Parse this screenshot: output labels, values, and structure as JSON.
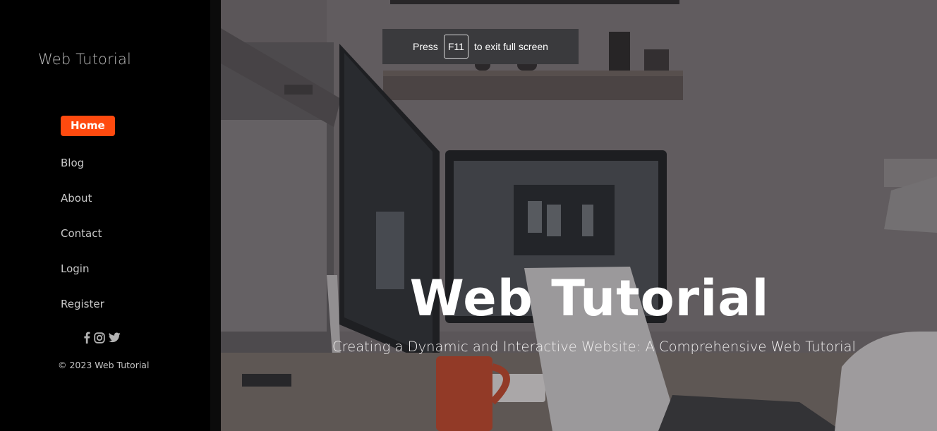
{
  "sidebar": {
    "brand": "Web Tutorial",
    "nav": [
      {
        "label": "Home",
        "active": true
      },
      {
        "label": "Blog",
        "active": false
      },
      {
        "label": "About",
        "active": false
      },
      {
        "label": "Contact",
        "active": false
      },
      {
        "label": "Login",
        "active": false
      },
      {
        "label": "Register",
        "active": false
      }
    ],
    "social_icons": [
      "facebook-icon",
      "instagram-icon",
      "twitter-icon"
    ],
    "copyright": "© 2023 Web Tutorial"
  },
  "hero": {
    "title": "Web Tutorial",
    "subtitle": "Creating a Dynamic and Interactive Website: A Comprehensive Web Tutorial"
  },
  "fullscreen_notice": {
    "prefix": "Press",
    "key": "F11",
    "suffix": "to exit full screen"
  },
  "colors": {
    "accent": "#ff4a0f",
    "sidebar_bg": "#000000",
    "toast_bg": "#3a3a3d"
  }
}
